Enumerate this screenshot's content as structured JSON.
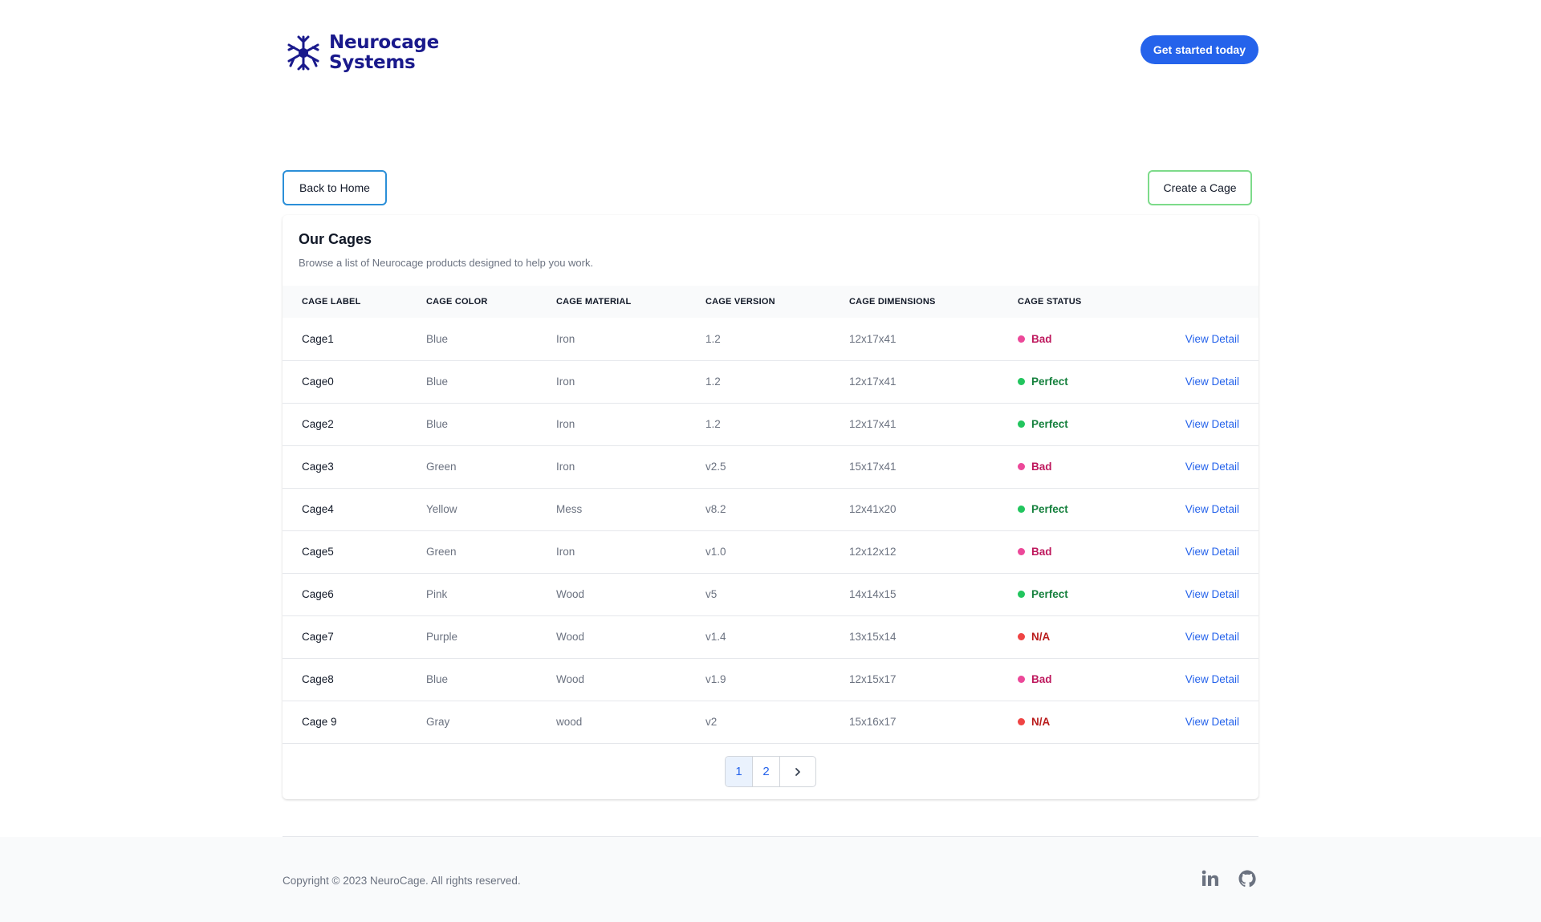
{
  "header": {
    "brand_line1": "Neurocage",
    "brand_line2": "Systems",
    "cta_label": "Get started today",
    "brand_color": "#1a1a8c",
    "accent_color": "#2563eb"
  },
  "actions": {
    "back_label": "Back to Home",
    "create_label": "Create a Cage"
  },
  "card": {
    "title": "Our Cages",
    "subtitle": "Browse a list of Neurocage products designed to help you work."
  },
  "table": {
    "columns": [
      "Cage Label",
      "Cage Color",
      "Cage Material",
      "Cage Version",
      "Cage Dimensions",
      "Cage Status"
    ],
    "view_label": "View Detail",
    "rows": [
      {
        "label": "Cage1",
        "color": "Blue",
        "material": "Iron",
        "version": "1.2",
        "dimensions": "12x17x41",
        "status": "Bad"
      },
      {
        "label": "Cage0",
        "color": "Blue",
        "material": "Iron",
        "version": "1.2",
        "dimensions": "12x17x41",
        "status": "Perfect"
      },
      {
        "label": "Cage2",
        "color": "Blue",
        "material": "Iron",
        "version": "1.2",
        "dimensions": "12x17x41",
        "status": "Perfect"
      },
      {
        "label": "Cage3",
        "color": "Green",
        "material": "Iron",
        "version": "v2.5",
        "dimensions": "15x17x41",
        "status": "Bad"
      },
      {
        "label": "Cage4",
        "color": "Yellow",
        "material": "Mess",
        "version": "v8.2",
        "dimensions": "12x41x20",
        "status": "Perfect"
      },
      {
        "label": "Cage5",
        "color": "Green",
        "material": "Iron",
        "version": "v1.0",
        "dimensions": "12x12x12",
        "status": "Bad"
      },
      {
        "label": "Cage6",
        "color": "Pink",
        "material": "Wood",
        "version": "v5",
        "dimensions": "14x14x15",
        "status": "Perfect"
      },
      {
        "label": "Cage7",
        "color": "Purple",
        "material": "Wood",
        "version": "v1.4",
        "dimensions": "13x15x14",
        "status": "N/A"
      },
      {
        "label": "Cage8",
        "color": "Blue",
        "material": "Wood",
        "version": "v1.9",
        "dimensions": "12x15x17",
        "status": "Bad"
      },
      {
        "label": "Cage 9",
        "color": "Gray",
        "material": "wood",
        "version": "v2",
        "dimensions": "15x16x17",
        "status": "N/A"
      }
    ],
    "status_styles": {
      "Bad": {
        "dot": "#ec4899",
        "text": "#be185d"
      },
      "Perfect": {
        "dot": "#22c55e",
        "text": "#15803d"
      },
      "N/A": {
        "dot": "#ef4444",
        "text": "#b91c1c"
      }
    }
  },
  "pagination": {
    "pages": [
      "1",
      "2"
    ],
    "current": "1",
    "next_icon": "chevron-right-icon"
  },
  "footer": {
    "copyright": "Copyright © 2023 NeuroCage. All rights reserved.",
    "social_icons": [
      "linkedin-icon",
      "github-icon"
    ]
  }
}
